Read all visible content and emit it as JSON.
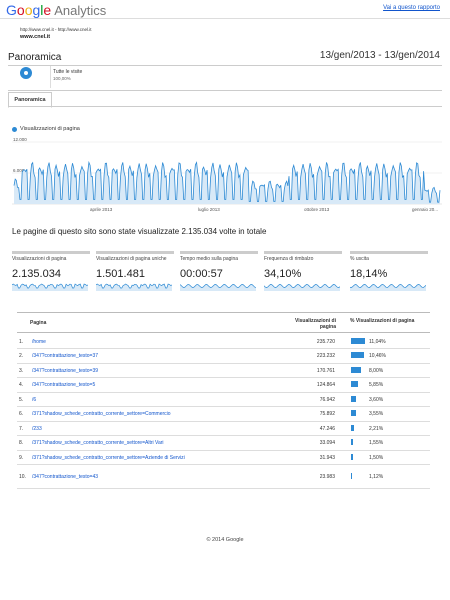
{
  "header": {
    "logo_letters": [
      "G",
      "o",
      "o",
      "g",
      "l",
      "e"
    ],
    "product": "Analytics",
    "report_link": "Vai a questo rapporto"
  },
  "site": {
    "urls": "http://www.cnel.it - http://www.cnel.it",
    "name": "www.cnel.it"
  },
  "page": {
    "title": "Panoramica",
    "date_range": "13/gen/2013 - 13/gen/2014"
  },
  "segment": {
    "name": "Tutte le visite",
    "percent": "100,00%"
  },
  "tabs": [
    {
      "label": "Panoramica",
      "active": true
    }
  ],
  "chart": {
    "legend": "Visualizzazioni di pagina",
    "y_ticks": [
      "12.000",
      "6.000"
    ],
    "x_ticks": [
      "aprile 2013",
      "luglio 2013",
      "ottobre 2013",
      "gennaio 20..."
    ]
  },
  "summary": {
    "title": "Le pagine di questo sito sono state visualizzate 2.135.034 volte in totale",
    "metrics": [
      {
        "label": "Visualizzazioni di pagina",
        "value": "2.135.034"
      },
      {
        "label": "Visualizzazioni di pagina uniche",
        "value": "1.501.481"
      },
      {
        "label": "Tempo medio sulla pagina",
        "value": "00:00:57"
      },
      {
        "label": "Frequenza di rimbalzo",
        "value": "34,10%"
      },
      {
        "label": "% uscita",
        "value": "18,14%"
      }
    ]
  },
  "table": {
    "columns": [
      "Pagina",
      "Visualizzazioni di pagina",
      "% Visualizzazioni di pagina"
    ],
    "rows": [
      {
        "index": "1.",
        "page": "/home",
        "views": "235.720",
        "pct": "11,04%",
        "share": 11.04
      },
      {
        "index": "2.",
        "page": "/347?contrattazione_testo=37",
        "views": "223.232",
        "pct": "10,46%",
        "share": 10.46
      },
      {
        "index": "3.",
        "page": "/347?contrattazione_testo=39",
        "views": "170.761",
        "pct": "8,00%",
        "share": 8.0
      },
      {
        "index": "4.",
        "page": "/347?contrattazione_testo=5",
        "views": "124.864",
        "pct": "5,85%",
        "share": 5.85
      },
      {
        "index": "5.",
        "page": "/6",
        "views": "76.942",
        "pct": "3,60%",
        "share": 3.6
      },
      {
        "index": "6.",
        "page": "/371?shadow_schede_contratto_corrente_settore=Commercio",
        "views": "75.892",
        "pct": "3,55%",
        "share": 3.55
      },
      {
        "index": "7.",
        "page": "/233",
        "views": "47.246",
        "pct": "2,21%",
        "share": 2.21
      },
      {
        "index": "8.",
        "page": "/371?shadow_schede_contratto_corrente_settore=Altri Vari",
        "views": "33.094",
        "pct": "1,55%",
        "share": 1.55
      },
      {
        "index": "9.",
        "page": "/371?shadow_schede_contratto_corrente_settore=Aziende di Servizi",
        "views": "31.943",
        "pct": "1,50%",
        "share": 1.5
      },
      {
        "index": "10.",
        "page": "/347?contrattazione_testo=43",
        "views": "23.983",
        "pct": "1,12%",
        "share": 1.12
      }
    ]
  },
  "footer": "© 2014 Google",
  "colors": {
    "accent": "#2d8ad4",
    "link": "#1155cc"
  }
}
